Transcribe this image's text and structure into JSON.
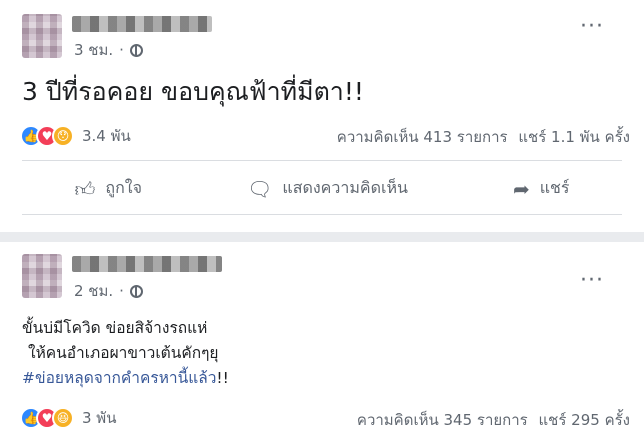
{
  "posts": [
    {
      "time": "3 ชม.",
      "privacy_icon": "globe-icon",
      "text": "3 ปีที่รอคอย ขอบคุณฟ้าที่มีตา!!",
      "reactions": {
        "icons": [
          "like",
          "love",
          "wow"
        ],
        "count": "3.4 พัน"
      },
      "comments": "ความคิดเห็น 413 รายการ",
      "shares": "แชร์ 1.1 พัน ครั้ง",
      "actions": {
        "like": "ถูกใจ",
        "comment": "แสดงความคิดเห็น",
        "share": "แชร์"
      }
    },
    {
      "time": "2 ชม.",
      "privacy_icon": "globe-icon",
      "text_line1": "ขั้นบ่มีโควิด ข่อยสิจ้างรถแห่",
      "text_line2": "ให้คนอำเภอผาขาวเต้นคักๆยุ",
      "hashtag": "#ข่อยหลุดจากคำครหานี้แล้ว",
      "hashtag_suffix": "!!",
      "reactions": {
        "icons": [
          "like",
          "love",
          "haha"
        ],
        "count": "3 พัน"
      },
      "comments": "ความคิดเห็น 345 รายการ",
      "shares": "แชร์ 295 ครั้ง"
    }
  ],
  "colors": {
    "link": "#385898",
    "muted": "#606770",
    "like": "#2d88ff",
    "love": "#f33e58",
    "wow": "#f7b125"
  }
}
